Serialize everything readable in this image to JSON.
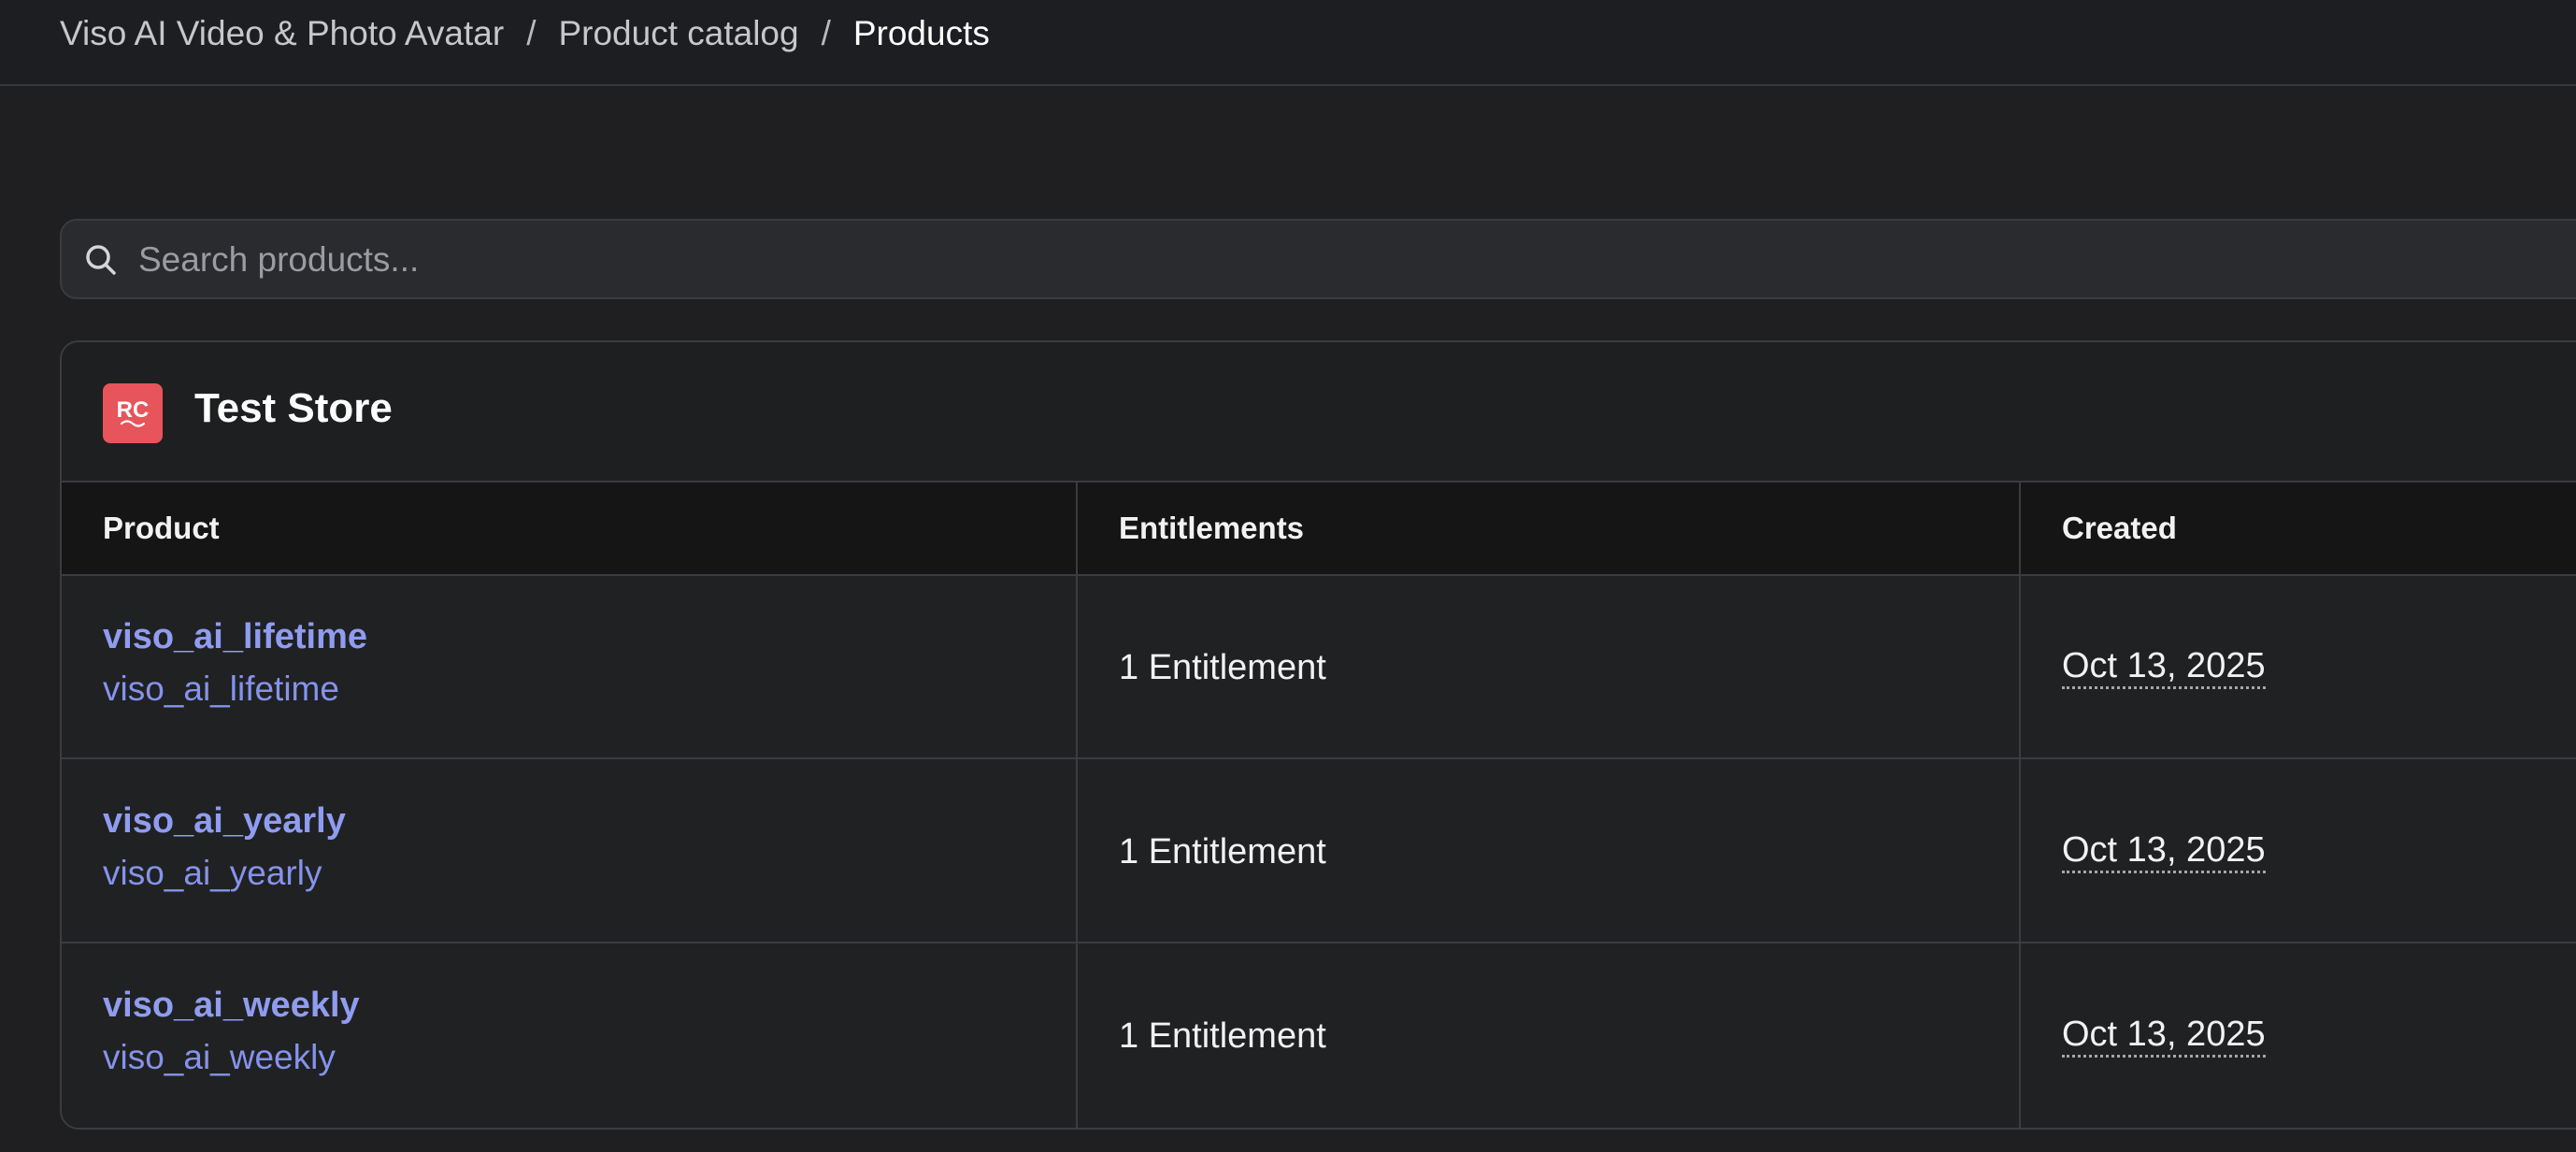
{
  "breadcrumb": {
    "items": [
      "Viso AI Video & Photo Avatar",
      "Product catalog",
      "Products"
    ],
    "separator": "/"
  },
  "search": {
    "placeholder": "Search products..."
  },
  "store": {
    "logo_text": "RC",
    "name": "Test Store"
  },
  "table": {
    "headers": [
      "Product",
      "Entitlements",
      "Created"
    ],
    "rows": [
      {
        "name": "viso_ai_lifetime",
        "identifier": "viso_ai_lifetime",
        "entitlements": "1 Entitlement",
        "created": "Oct 13, 2025"
      },
      {
        "name": "viso_ai_yearly",
        "identifier": "viso_ai_yearly",
        "entitlements": "1 Entitlement",
        "created": "Oct 13, 2025"
      },
      {
        "name": "viso_ai_weekly",
        "identifier": "viso_ai_weekly",
        "entitlements": "1 Entitlement",
        "created": "Oct 13, 2025"
      }
    ]
  },
  "colors": {
    "background": "#1f1f22",
    "link": "#8f9cf0",
    "logo": "#e8545c",
    "border": "#3b3c40"
  }
}
